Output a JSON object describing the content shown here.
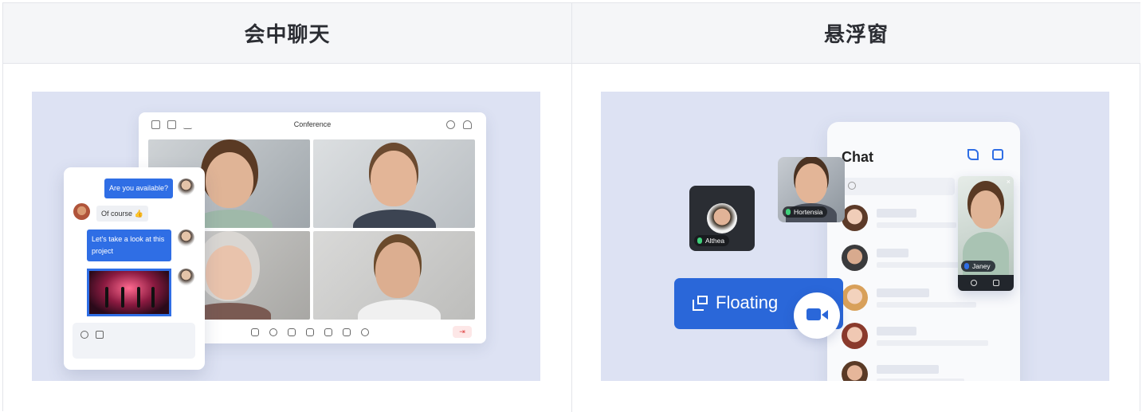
{
  "columns": [
    {
      "title": "会中聊天"
    },
    {
      "title": "悬浮窗"
    }
  ],
  "conference": {
    "title": "Conference",
    "leave_icon": "exit-icon"
  },
  "chat_popup": {
    "messages": [
      {
        "text": "Are you available?",
        "mine": true
      },
      {
        "text": "Of course 👍",
        "mine": false
      },
      {
        "text": "Let's take a look at this project",
        "mine": true
      }
    ]
  },
  "floating": {
    "chat_title": "Chat",
    "button_label": "Floating",
    "participants": [
      {
        "name": "Althea"
      },
      {
        "name": "Hortensia"
      },
      {
        "name": "Janey"
      }
    ]
  },
  "colors": {
    "accent": "#2f6ee5",
    "panel_bg": "#dde2f3",
    "header_bg": "#f5f6f8"
  }
}
